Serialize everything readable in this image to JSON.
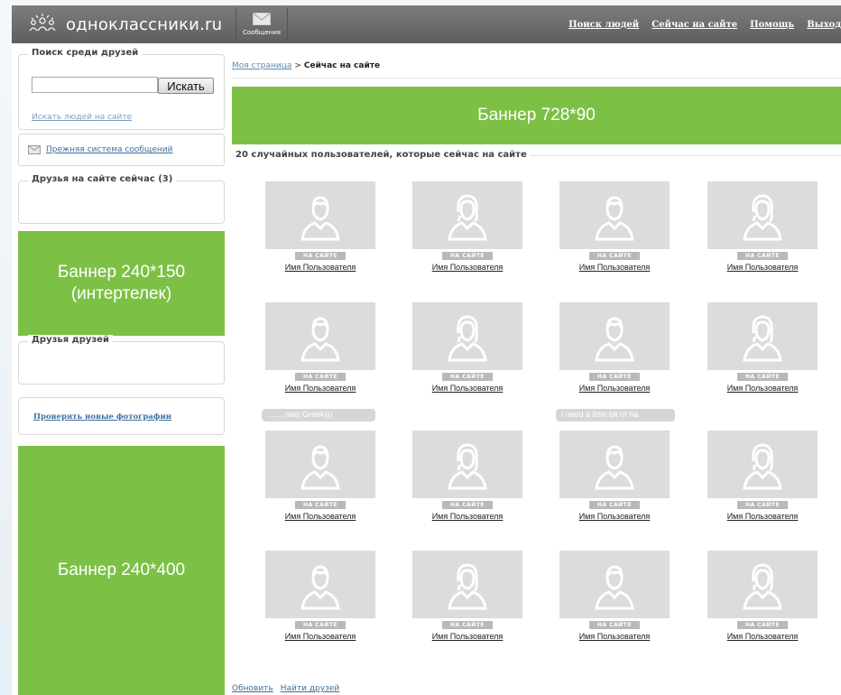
{
  "header": {
    "logo_text": "одноклассники.ru",
    "messages_label": "Сообщения",
    "nav": [
      "Поиск людей",
      "Сейчас на сайте",
      "Помощь",
      "Выход"
    ]
  },
  "sidebar": {
    "search_title": "Поиск среди друзей",
    "search_input_value": "",
    "search_button": "Искать",
    "search_people_link": "Искать людей на сайте",
    "old_messages_link": "Прежняя система сообщений",
    "friends_online_title": "Друзья на сайте сейчас (3)",
    "banner_240_150": "Баннер 240*150\n(интертелек)",
    "friends_of_friends_title": "Друзья друзей",
    "check_photos_link": "Проверять новые фотографии",
    "banner_240_400": "Баннер 240*400"
  },
  "main": {
    "breadcrumb_link": "Моя страница",
    "breadcrumb_sep": ">",
    "breadcrumb_current": "Сейчас на сайте",
    "banner_top": "Баннер 728*90",
    "section_title": "20 случайных пользователей, которые сейчас на сайте",
    "online_badge": "НА САЙТЕ",
    "users": [
      {
        "name": "Имя Пользователя",
        "gender": "male"
      },
      {
        "name": "Имя Пользователя",
        "gender": "female"
      },
      {
        "name": "Имя Пользователя",
        "gender": "male"
      },
      {
        "name": "Имя Пользователя",
        "gender": "female"
      },
      {
        "name": "Имя Пользователя",
        "gender": "male"
      },
      {
        "name": "Имя Пользователя",
        "gender": "female"
      },
      {
        "name": "Имя Пользователя",
        "gender": "male"
      },
      {
        "name": "Имя Пользователя",
        "gender": "female"
      },
      {
        "name": "Имя Пользователя",
        "gender": "male",
        "bubble": "........nais Greek)))"
      },
      {
        "name": "Имя Пользователя",
        "gender": "female"
      },
      {
        "name": "Имя Пользователя",
        "gender": "male",
        "bubble": "i need a little bit of ha"
      },
      {
        "name": "Имя Пользователя",
        "gender": "female"
      },
      {
        "name": "Имя Пользователя",
        "gender": "male"
      },
      {
        "name": "Имя Пользователя",
        "gender": "female"
      },
      {
        "name": "Имя Пользователя",
        "gender": "male"
      },
      {
        "name": "Имя Пользователя",
        "gender": "female"
      }
    ],
    "footer_links": [
      "Обновить",
      "Найти друзей"
    ]
  },
  "colors": {
    "banner_green": "#7cc146",
    "header_gray": "#6a6a6a",
    "link_blue": "#3d6f9e",
    "photo_bg": "#dcdcdc"
  }
}
